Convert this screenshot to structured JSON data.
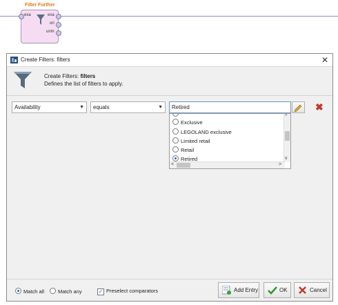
{
  "operator": {
    "title": "Filter Further",
    "in_port": "exa",
    "out_ports": [
      "exa",
      "ori",
      "unm"
    ]
  },
  "dialog": {
    "title": "Create Filters: filters",
    "header_prefix": "Create Filters: ",
    "header_bold": "filters",
    "description": "Defines the list of filters to apply."
  },
  "filter_row": {
    "attribute": "Availability",
    "operator": "equals",
    "value": "Retired"
  },
  "dropdown_options": [
    {
      "label": "Exclusive",
      "selected": false
    },
    {
      "label": "LEGOLAND exclusive",
      "selected": false
    },
    {
      "label": "Limited retail",
      "selected": false
    },
    {
      "label": "Retail",
      "selected": false
    },
    {
      "label": "Retired",
      "selected": true
    }
  ],
  "footer": {
    "match_all": "Match all",
    "match_any": "Match any",
    "match_selected": "all",
    "preselect": "Preselect comparators",
    "preselect_checked": true,
    "add_entry": "Add Entry",
    "ok": "OK",
    "cancel": "Cancel"
  },
  "colors": {
    "operator_title": "#e07a10",
    "operator_fill": "#f6dcf2",
    "delete": "#c0392b",
    "accent": "#1f6fbf"
  }
}
